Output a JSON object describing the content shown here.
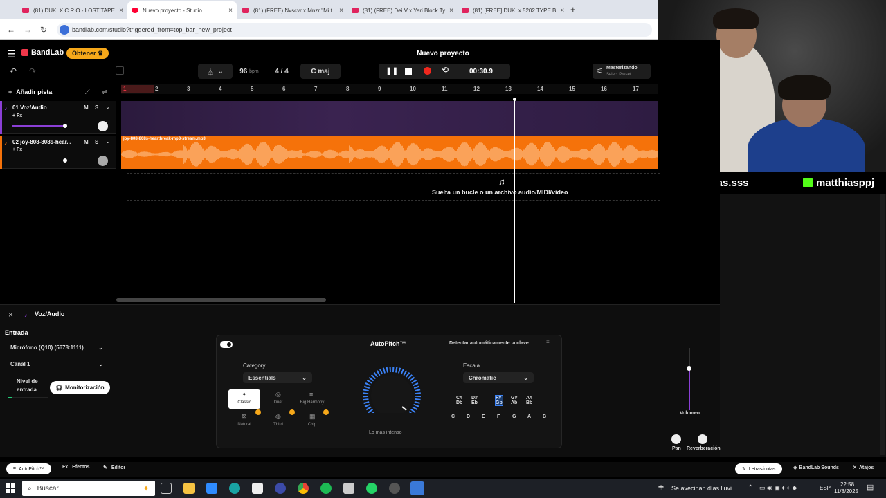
{
  "browser": {
    "tabs": [
      {
        "title": "(81) DUKI X C.R.O - LOST TAPE",
        "icon": "youtube-icon"
      },
      {
        "title": "Nuevo proyecto - Studio",
        "icon": "bandlab-icon",
        "active": true
      },
      {
        "title": "(81) (FREE) Nvscvr x Mnzr \"Mi t",
        "icon": "youtube-icon"
      },
      {
        "title": "(81) (FREE) Dei V x Yari Block Ty",
        "icon": "youtube-icon"
      },
      {
        "title": "(81) [FREE] DUKI x 5202 TYPE B",
        "icon": "youtube-icon"
      }
    ],
    "new_tab": "+",
    "url": "bandlab.com/studio?triggered_from=top_bar_new_project"
  },
  "app": {
    "brand": "BandLab",
    "get_button": "Obtener",
    "project_title": "Nuevo proyecto",
    "bpm": "96",
    "bpm_unit": "bpm",
    "time_sig": "4 / 4",
    "key": "C maj",
    "time": "00:30.9",
    "mastering_label": "Masterizando",
    "mastering_sub": "Select Preset",
    "add_track": "Añadir pista",
    "ruler": [
      "1",
      "2",
      "3",
      "4",
      "5",
      "6",
      "7",
      "8",
      "9",
      "10",
      "11",
      "12",
      "13",
      "14",
      "15",
      "16",
      "17"
    ],
    "tracks": [
      {
        "name": "01  Voz/Audio",
        "fx": "+ Fx",
        "m": "M",
        "s": "S",
        "color": "#8b3fd6"
      },
      {
        "name": "02  joy-808-808s-hear...",
        "fx": "+ Fx",
        "m": "M",
        "s": "S",
        "color": "#f5720a"
      }
    ],
    "clip_name": "joy-808-808s-heartbreak-mp3-stream.mp3",
    "drop_text": "Suelta un bucle o un archivo audio/MIDI/video"
  },
  "social": {
    "instagram": "@matthias.sss",
    "kick": "matthiasppj"
  },
  "panel": {
    "title": "Voz/Audio",
    "input_label": "Entrada",
    "mic": "Micrófono (Q10) (5678:1111)",
    "channel": "Canal 1",
    "level_label": "Nivel de entrada",
    "monitor_button": "Monitorización",
    "autopitch_title": "AutoPitch™",
    "detect_key": "Detectar automáticamente la clave",
    "category_label": "Category",
    "category_value": "Essentials",
    "presets": [
      "Classic",
      "Duet",
      "Big Harmony",
      "Natural",
      "Third",
      "Chip"
    ],
    "knob_label": "Lo más intenso",
    "scale_label": "Escala",
    "scale_value": "Chromatic",
    "sharps": [
      "C#\nDb",
      "D#\nEb",
      "F#\nGb",
      "G#\nAb",
      "A#\nBb"
    ],
    "naturals": [
      "C",
      "D",
      "E",
      "F",
      "G",
      "A",
      "B"
    ],
    "volume_label": "Volumen",
    "pan_label": "Pan",
    "reverb_label": "Reverberación"
  },
  "bottom_tabs": {
    "autopitch": "AutoPitch™",
    "effects": "Efectos",
    "editor": "Editor",
    "lyrics": "Letras/notas",
    "sounds": "BandLab Sounds",
    "shortcuts": "Atajos"
  },
  "taskbar": {
    "search": "Buscar",
    "weather": "Se avecinan días lluvi...",
    "lang": "ESP",
    "time": "22:58",
    "date": "11/8/2025"
  },
  "colors": {
    "accent_orange": "#f5720a",
    "accent_purple": "#8b3fd6",
    "knob_blue": "#3b82f6"
  }
}
